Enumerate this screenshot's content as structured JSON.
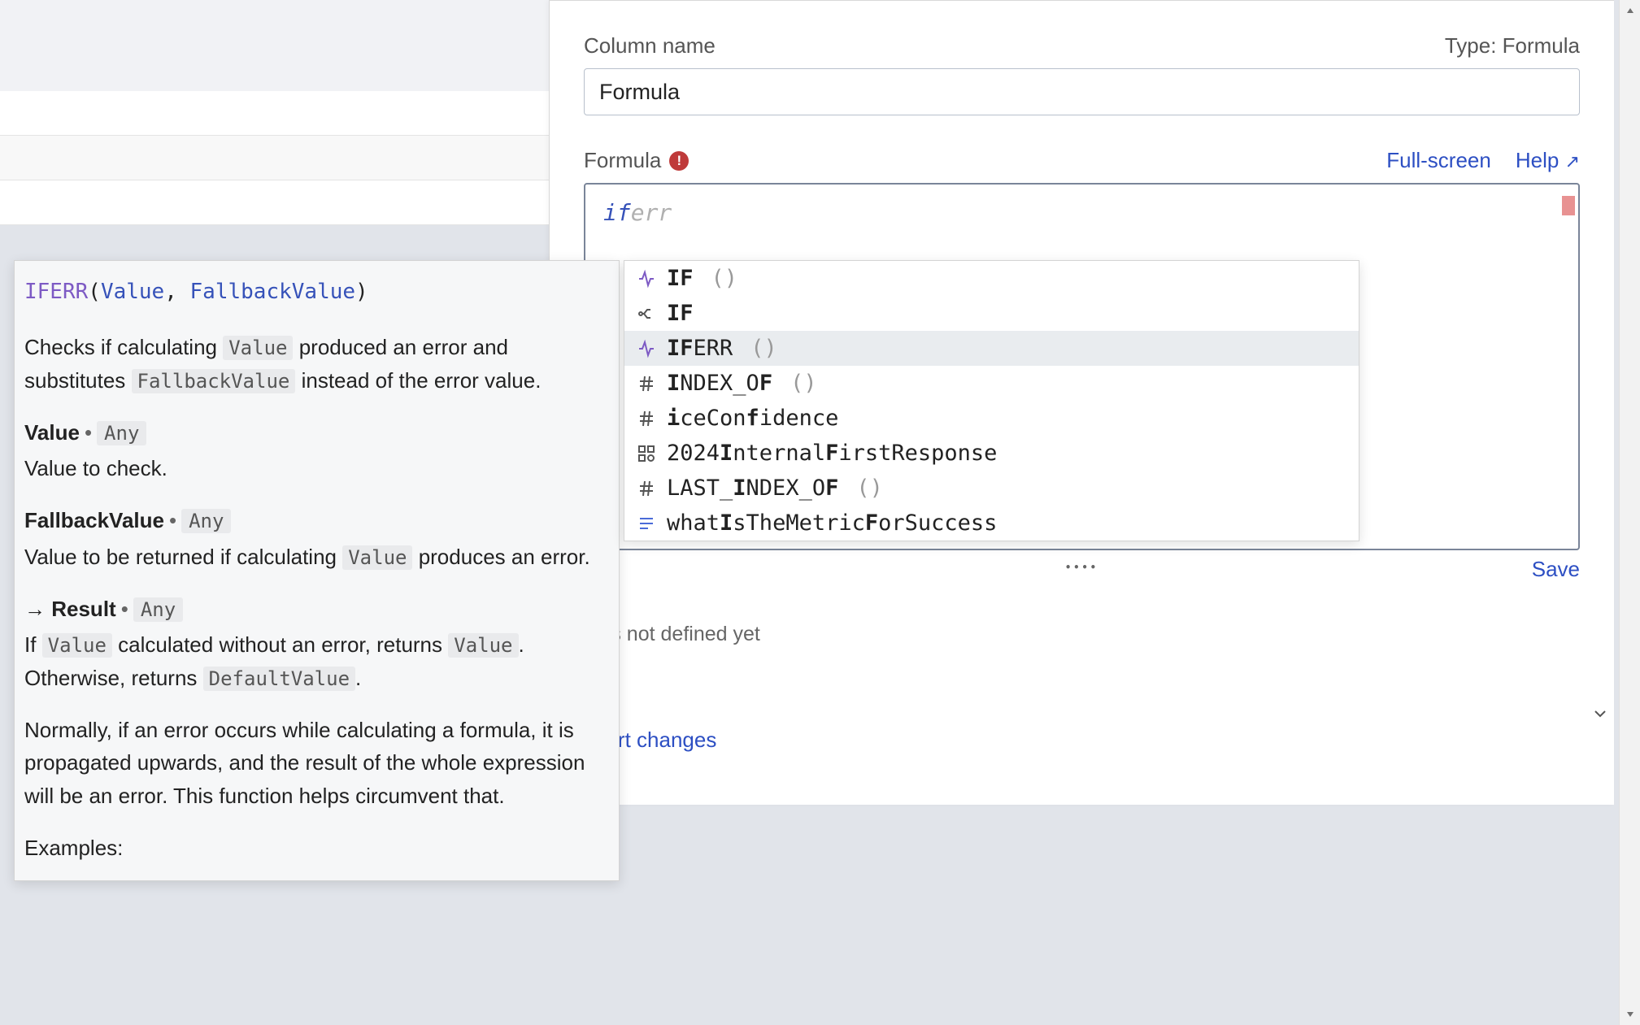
{
  "panel": {
    "column_name_label": "Column name",
    "type_label": "Type: Formula",
    "column_name_value": "Formula",
    "formula_label": "Formula",
    "fullscreen_label": "Full-screen",
    "help_label": "Help",
    "help_arrow": "↗",
    "formula_typed": "if",
    "formula_hint": "err",
    "save_label": "Save",
    "variables_text": "bles not defined yet",
    "revert_label": "evert changes",
    "resize_dots": "••••"
  },
  "autocomplete": {
    "items": [
      {
        "icon": "fn",
        "prefix": "IF",
        "rest": "",
        "parens": "()",
        "selected": false
      },
      {
        "icon": "branch",
        "prefix": "IF",
        "rest": "",
        "parens": "",
        "selected": false
      },
      {
        "icon": "fn",
        "prefix": "IF",
        "rest": "ERR",
        "parens": "()",
        "selected": true
      },
      {
        "icon": "hash",
        "prefix": "I",
        "rest": "NDEX_O",
        "suffix": "F",
        "parens": "()",
        "selected": false
      },
      {
        "icon": "hash",
        "prefix": "i",
        "rest": "ceCon",
        "suffix": "f",
        "tail": "idence",
        "parens": "",
        "selected": false
      },
      {
        "icon": "grid",
        "prefix": "",
        "rest": "2024",
        "suffix": "I",
        "tail": "nternal",
        "suffix2": "F",
        "tail2": "irstResponse",
        "parens": "",
        "selected": false
      },
      {
        "icon": "hash",
        "prefix": "",
        "rest": "LAST_",
        "suffix": "I",
        "tail": "NDEX_O",
        "suffix2": "F",
        "parens": "()",
        "selected": false
      },
      {
        "icon": "lines",
        "prefix": "",
        "rest": "what",
        "suffix": "I",
        "tail": "sTheMetric",
        "suffix2": "F",
        "tail2": "orSuccess",
        "parens": "",
        "selected": false
      }
    ]
  },
  "tooltip": {
    "sig_fn": "IFERR",
    "sig_arg1": "Value",
    "sig_arg2": "FallbackValue",
    "desc_1a": "Checks if calculating ",
    "desc_1_value": "Value",
    "desc_1b": " produced an error and substitutes ",
    "desc_1_fallback": "FallbackValue",
    "desc_1c": " instead of the error value.",
    "param1_name": "Value",
    "param1_type": "Any",
    "param1_desc": "Value to check.",
    "param2_name": "FallbackValue",
    "param2_type": "Any",
    "param2_desca": "Value to be returned if calculating ",
    "param2_desc_value": "Value",
    "param2_descb": " produces an error.",
    "result_arrow": "→",
    "result_label": "Result",
    "result_type": "Any",
    "result_desca": "If ",
    "result_desc_value1": "Value",
    "result_descb": " calculated without an error, returns ",
    "result_desc_value2": "Value",
    "result_descc": ". Otherwise, returns ",
    "result_desc_default": "DefaultValue",
    "result_descd": ".",
    "note": "Normally, if an error occurs while calculating a formula, it is propagated upwards, and the result of the whole expression will be an error. This function helps circumvent that.",
    "examples_label": "Examples:"
  }
}
